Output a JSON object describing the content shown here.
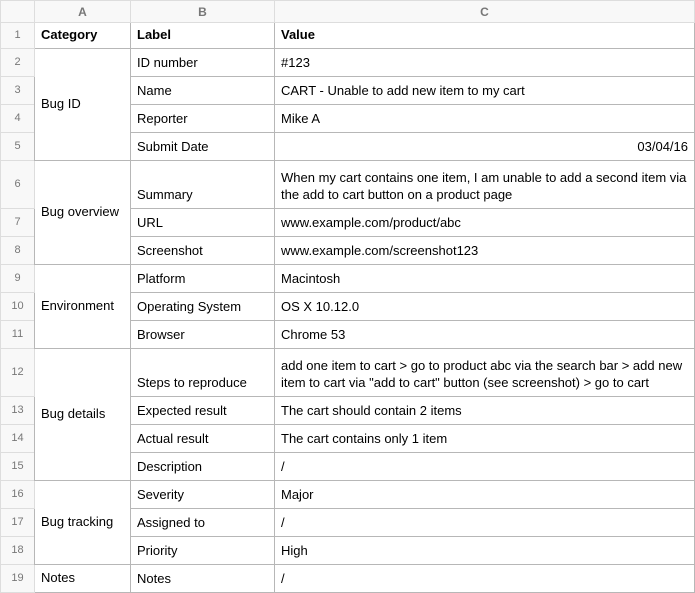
{
  "columns": {
    "A": "A",
    "B": "B",
    "C": "C"
  },
  "header": {
    "category": "Category",
    "label": "Label",
    "value": "Value"
  },
  "sections": [
    {
      "category": "Bug ID",
      "rows": [
        {
          "label": "ID number",
          "value": "#123"
        },
        {
          "label": "Name",
          "value": "CART - Unable to add new item to my cart"
        },
        {
          "label": "Reporter",
          "value": "Mike A"
        },
        {
          "label": "Submit Date",
          "value": "03/04/16",
          "align": "right"
        }
      ]
    },
    {
      "category": "Bug overview",
      "rows": [
        {
          "label": "Summary",
          "value": "When my cart contains one item, I am unable to add a second item via the add to cart button on a product page",
          "tall": true
        },
        {
          "label": "URL",
          "value": "www.example.com/product/abc"
        },
        {
          "label": "Screenshot",
          "value": "www.example.com/screenshot123"
        }
      ]
    },
    {
      "category": "Environment",
      "rows": [
        {
          "label": "Platform",
          "value": "Macintosh"
        },
        {
          "label": "Operating System",
          "value": "OS X 10.12.0"
        },
        {
          "label": "Browser",
          "value": "Chrome 53"
        }
      ]
    },
    {
      "category": "Bug details",
      "rows": [
        {
          "label": "Steps to reproduce",
          "value": "add one item to cart > go to product abc via the search bar > add new item to cart via \"add to cart\" button (see screenshot) > go to cart",
          "tall": true
        },
        {
          "label": "Expected result",
          "value": "The cart should contain 2 items"
        },
        {
          "label": "Actual result",
          "value": "The cart contains only 1 item"
        },
        {
          "label": "Description",
          "value": "/"
        }
      ]
    },
    {
      "category": "Bug tracking",
      "rows": [
        {
          "label": "Severity",
          "value": "Major"
        },
        {
          "label": "Assigned to",
          "value": "/"
        },
        {
          "label": "Priority",
          "value": "High"
        }
      ]
    },
    {
      "category": "Notes",
      "rows": [
        {
          "label": "Notes",
          "value": "/"
        }
      ]
    }
  ]
}
